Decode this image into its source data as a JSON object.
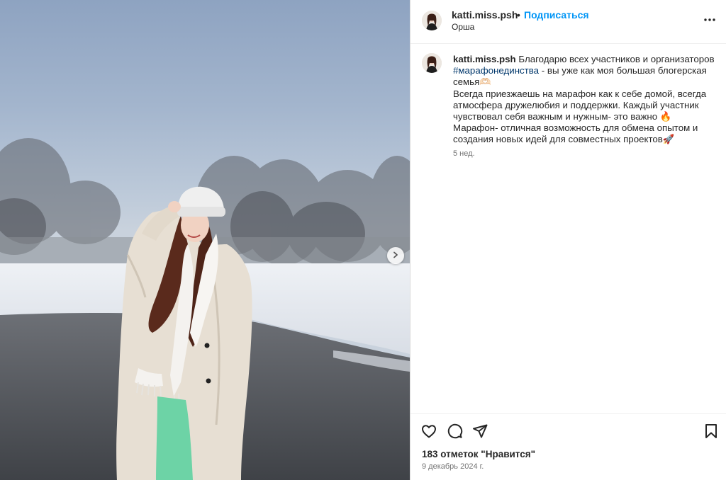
{
  "post": {
    "username": "katti.miss.psh",
    "separator": "•",
    "follow_label": "Подписаться",
    "location": "Орша",
    "more_icon": "more-horizontal-icon"
  },
  "caption": {
    "username": "katti.miss.psh",
    "text_before_hashtag": " Благодарю всех участников и организаторов ",
    "hashtag": "#марафонединства",
    "text_after_hashtag": " - вы уже как моя большая блогерская семья🫶🏻\nВсегда приезжаешь на марафон как к себе домой, всегда атмосфера дружелюбия и поддержки. Каждый участник чувствовал себя важным и нужным- это важно 🔥\nМарафон- отличная возможность для обмена опытом и создания новых идей для совместных проектов🚀",
    "time_ago": "5 нед."
  },
  "actions": {
    "like_icon": "heart-icon",
    "comment_icon": "comment-icon",
    "share_icon": "send-icon",
    "save_icon": "bookmark-icon",
    "likes_text": "183 отметок \"Нравится\"",
    "date": "9 декабрь 2024 г."
  },
  "media": {
    "next_icon": "chevron-right-icon",
    "description_colors": {
      "sky": "#a3b5cd",
      "snow": "#e4e8ee",
      "road": "#4a4d52",
      "coat": "#e6ddd0",
      "pants": "#6dd3a6"
    }
  },
  "colors": {
    "link_blue": "#0095f6",
    "hashtag": "#00376b",
    "secondary_text": "#737373",
    "border": "#dbdbdb"
  }
}
